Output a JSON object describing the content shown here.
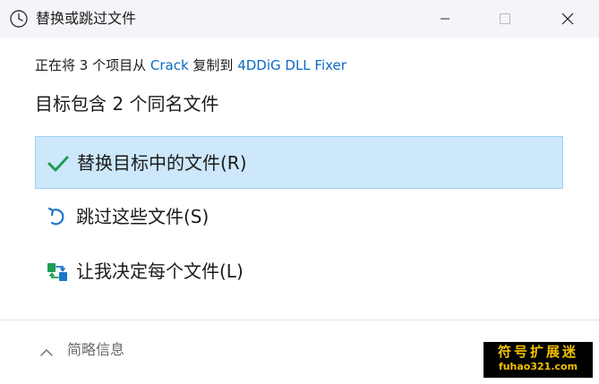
{
  "window": {
    "title": "替换或跳过文件",
    "icon": "clock-icon"
  },
  "source": {
    "prefix": "正在将 3 个项目从 ",
    "from": "Crack",
    "middle": " 复制到 ",
    "to": "4DDiG DLL Fixer"
  },
  "heading": "目标包含 2 个同名文件",
  "options": [
    {
      "label": "替换目标中的文件(R)",
      "icon": "checkmark-icon",
      "selected": true
    },
    {
      "label": "跳过这些文件(S)",
      "icon": "undo-arrow-icon",
      "selected": false
    },
    {
      "label": "让我决定每个文件(L)",
      "icon": "compare-files-icon",
      "selected": false
    }
  ],
  "footer": {
    "details_label": "简略信息"
  },
  "watermark": {
    "line1": "符号扩展迷",
    "line2": "fuhao321.com"
  },
  "colors": {
    "accent": "#0a6ac6",
    "selected_bg": "#cce8fa",
    "check_green": "#1f9d55"
  }
}
